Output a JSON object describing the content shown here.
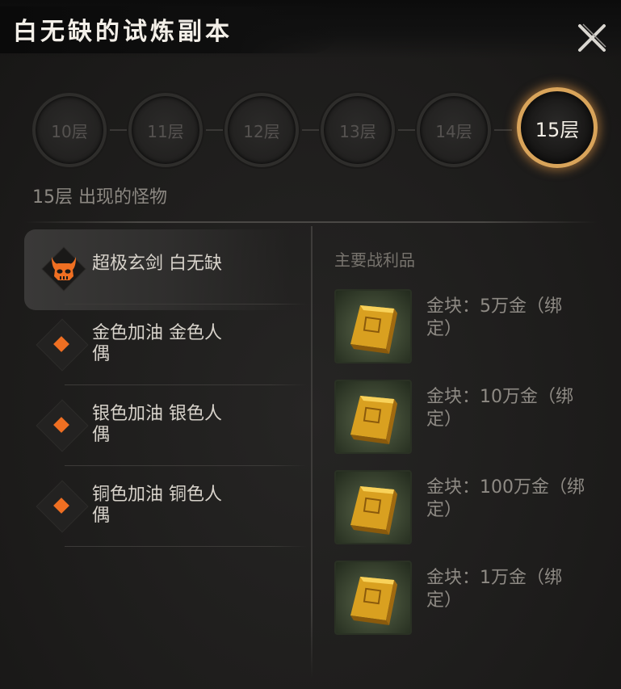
{
  "header": {
    "title": "白无缺的试炼副本"
  },
  "floors": [
    "10层",
    "11层",
    "12层",
    "13层",
    "14层",
    "15层"
  ],
  "selected_floor_label": "15层 出现的怪物",
  "monsters": [
    {
      "label": "超极玄剑 白无缺",
      "icon": "demon-skull-icon",
      "active": true
    },
    {
      "label_line1": "金色加油 金色人",
      "label_line2": "偶",
      "icon": "diamond-icon"
    },
    {
      "label_line1": "银色加油 银色人",
      "label_line2": "偶",
      "icon": "diamond-icon"
    },
    {
      "label_line1": "铜色加油 铜色人",
      "label_line2": "偶",
      "icon": "diamond-icon"
    }
  ],
  "loot": {
    "title": "主要战利品",
    "items": [
      {
        "line1": "金块：5万金（绑",
        "line2": "定）",
        "icon": "gold-bar-icon"
      },
      {
        "line1": "金块：10万金（绑",
        "line2": "定）",
        "icon": "gold-bar-icon"
      },
      {
        "line1": "金块：100万金（绑",
        "line2": "定）",
        "icon": "gold-bar-icon"
      },
      {
        "line1": "金块：1万金（绑",
        "line2": "定）",
        "icon": "gold-bar-icon"
      }
    ]
  },
  "colors": {
    "accent": "#ef6f22",
    "ring": "#d9a45a",
    "text": "#d8d3cb"
  }
}
